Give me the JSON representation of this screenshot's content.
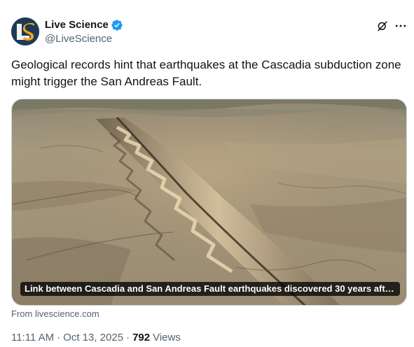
{
  "author": {
    "display_name": "Live Science",
    "handle": "@LiveScience",
    "avatar_initials": "LS",
    "verified": true
  },
  "tweet": {
    "text": "Geological records hint that earthquakes at the Cascadia subduction zone might trigger the San Andreas Fault."
  },
  "card": {
    "title": "Link between Cascadia and San Andreas Fault earthquakes discovered 30 years after l...",
    "source": "From livescience.com"
  },
  "meta": {
    "time": "11:11 AM",
    "date": "Oct 13, 2025",
    "separator": "·",
    "views_count": "792",
    "views_label": "Views"
  },
  "icons": {
    "grok": "grok-icon",
    "more": "more-icon",
    "verified": "verified-badge-icon"
  },
  "colors": {
    "verified_blue": "#1d9bf0",
    "secondary_text": "#536471",
    "avatar_bg": "#1d3a57"
  }
}
